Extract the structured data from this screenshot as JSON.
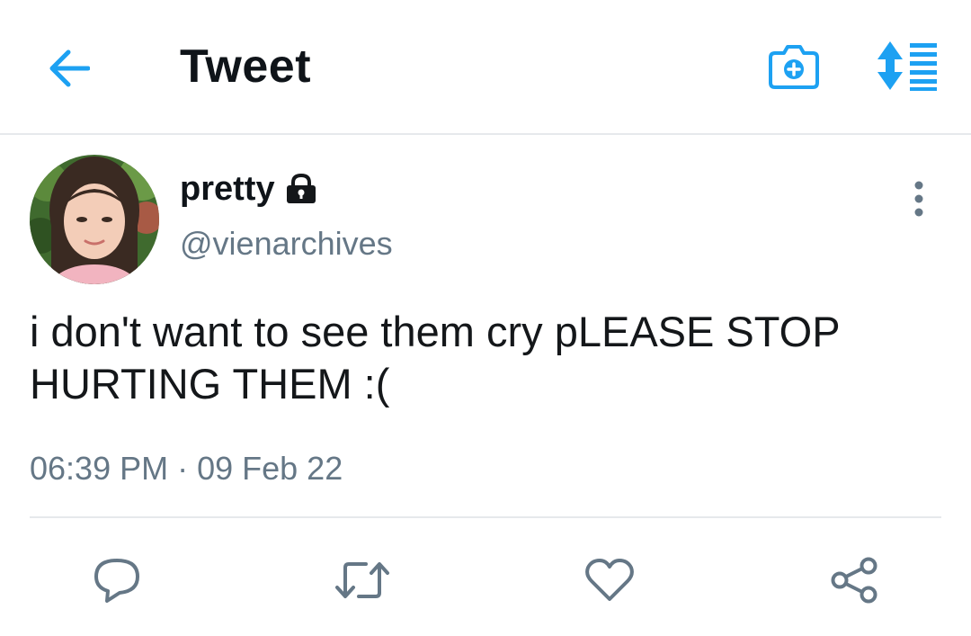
{
  "header": {
    "title": "Tweet",
    "back_icon": "arrow-left-icon",
    "camera_icon": "camera-plus-icon",
    "sort_icon": "sort-arrows-icon",
    "accent_color": "#1da1f2"
  },
  "tweet": {
    "display_name": "pretty",
    "protected_icon": "lock-icon",
    "handle": "@vienarchives",
    "text": "i don't want to see them cry pLEASE STOP HURTING THEM :(",
    "time": "06:39 PM",
    "separator": "·",
    "date": "09 Feb 22",
    "more_icon": "more-vertical-icon"
  },
  "actions": {
    "reply_icon": "reply-bubble-icon",
    "retweet_icon": "retweet-icon",
    "like_icon": "heart-icon",
    "share_icon": "share-icon",
    "icon_color": "#657786"
  }
}
